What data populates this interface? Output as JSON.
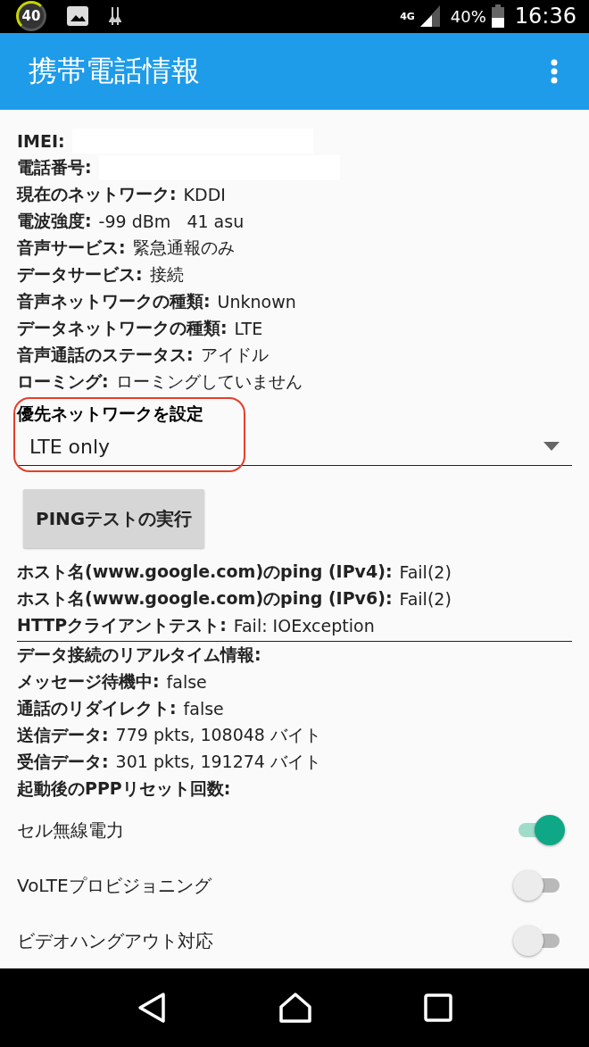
{
  "status_bar": {
    "notification_count": "40",
    "network_type": "4G",
    "battery": "40%",
    "time": "16:36"
  },
  "app_bar": {
    "title": "携帯電話情報"
  },
  "info_rows": [
    {
      "label": "IMEI:",
      "redacted": true
    },
    {
      "label": "電話番号:",
      "redacted": true
    },
    {
      "label": "現在のネットワーク:",
      "value": "KDDI"
    },
    {
      "label": "電波強度:",
      "value": "-99 dBm   41 asu"
    },
    {
      "label": "音声サービス:",
      "value": "緊急通報のみ"
    },
    {
      "label": "データサービス:",
      "value": "接続"
    },
    {
      "label": "音声ネットワークの種類:",
      "value": "Unknown"
    },
    {
      "label": "データネットワークの種類:",
      "value": "LTE"
    },
    {
      "label": "音声通話のステータス:",
      "value": "アイドル"
    },
    {
      "label": "ローミング:",
      "value": "ローミングしていません"
    }
  ],
  "preferred_network": {
    "label": "優先ネットワークを設定",
    "value": "LTE only",
    "highlighted": true
  },
  "ping_button": {
    "label": "PINGテストの実行"
  },
  "test_rows": [
    {
      "label": "ホスト名(www.google.com)のping (IPv4):",
      "value": "Fail(2)"
    },
    {
      "label": "ホスト名(www.google.com)のping (IPv6):",
      "value": "Fail(2)"
    },
    {
      "label": "HTTPクライアントテスト:",
      "value": "Fail: IOException"
    }
  ],
  "data_rows": [
    {
      "label": "データ接続のリアルタイム情報:"
    },
    {
      "label": "メッセージ待機中:",
      "value": "false"
    },
    {
      "label": "通話のリダイレクト:",
      "value": "false"
    },
    {
      "label": "送信データ:",
      "value": "779 pkts, 108048 バイト"
    },
    {
      "label": "受信データ:",
      "value": "301 pkts, 191274 バイト"
    },
    {
      "label": "起動後のPPPリセット回数:"
    }
  ],
  "switches": [
    {
      "label": "セル無線電力",
      "on": true
    },
    {
      "label": "VoLTEプロビジョニング",
      "on": false
    },
    {
      "label": "ビデオハングアウト対応",
      "on": false
    }
  ]
}
